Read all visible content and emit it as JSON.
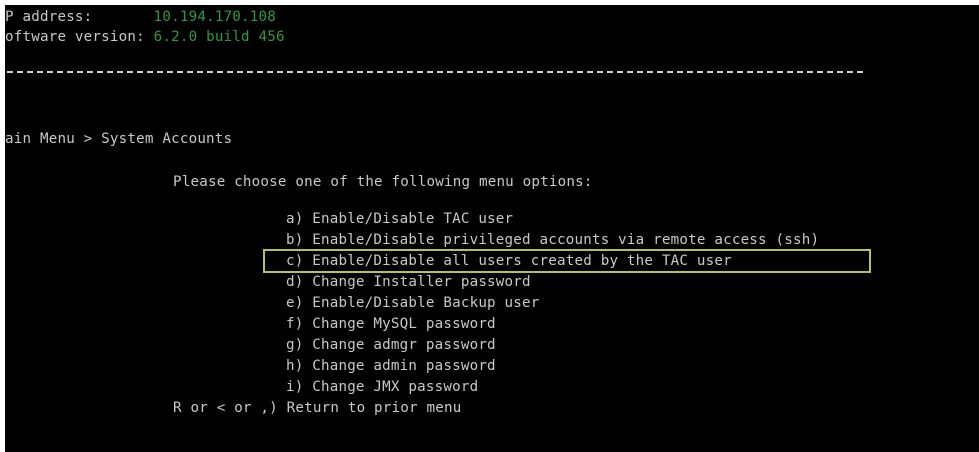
{
  "header": {
    "ip_label": "P address:",
    "ip_value": "10.194.170.108",
    "software_label": "oftware version:",
    "software_value": "6.2.0 build 456"
  },
  "breadcrumb": "ain Menu > System Accounts",
  "prompt": "Please choose one of the following menu options:",
  "menu": {
    "options": [
      "a) Enable/Disable TAC user",
      "b) Enable/Disable privileged accounts via remote access (ssh)",
      "c) Enable/Disable all users created by the TAC user",
      "d) Change Installer password",
      "e) Enable/Disable Backup user",
      "f) Change MySQL password",
      "g) Change admgr password",
      "h) Change admin password",
      "i) Change JMX password"
    ],
    "return_option": "R or < or ,) Return to prior menu"
  },
  "colors": {
    "background": "#000000",
    "text": "#c8c8c8",
    "value_green": "#2f9a3a",
    "highlight_border": "#b7c34a"
  }
}
